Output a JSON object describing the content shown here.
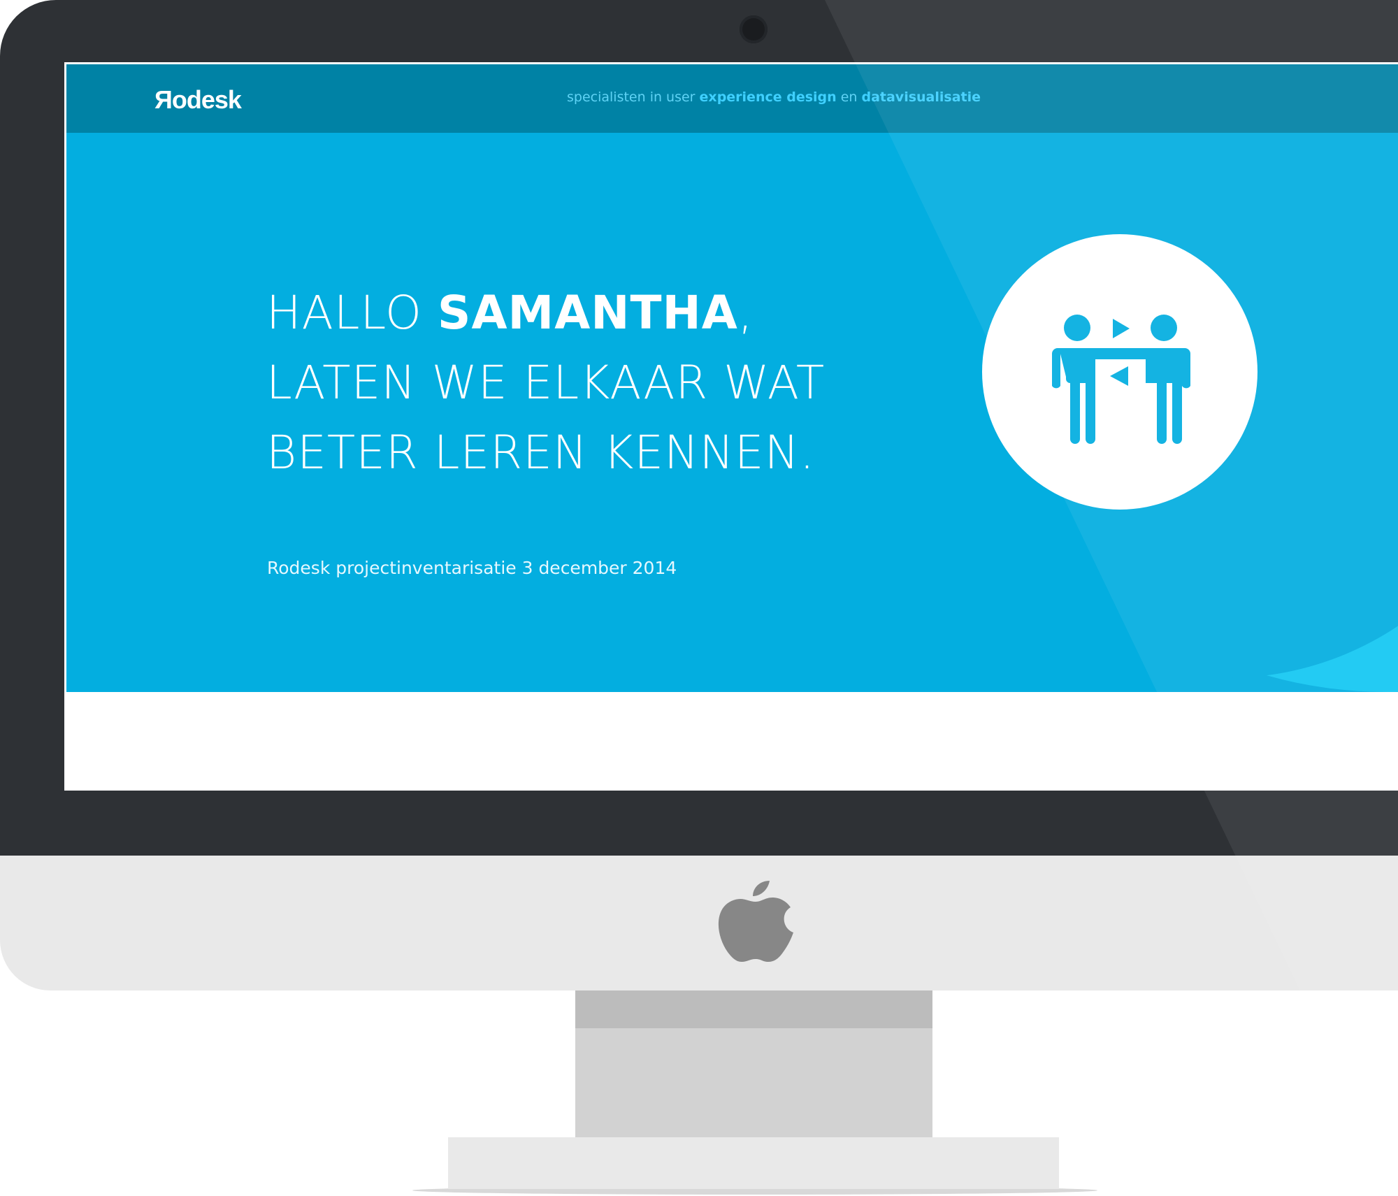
{
  "screen": {
    "brand": "Яodesk",
    "tagline": {
      "part1": "specialisten in user ",
      "bold1": "experience design",
      "part2": " en ",
      "bold2": "datavisualisatie"
    },
    "headline": {
      "greeting": "HALLO ",
      "name": "SAMANTHA",
      "comma": ",",
      "line2": "LATEN WE ELKAAR WAT",
      "line3": "BETER LEREN KENNEN."
    },
    "subtitle": "Rodesk projectinventarisatie 3 december 2014",
    "icon": "two-people-meeting-icon"
  },
  "device": {
    "logo": "apple-icon"
  },
  "colors": {
    "topbar": "#0082a5",
    "hero": "#03aee0",
    "accent": "#3fd0ff",
    "bezel": "#2e3135"
  }
}
